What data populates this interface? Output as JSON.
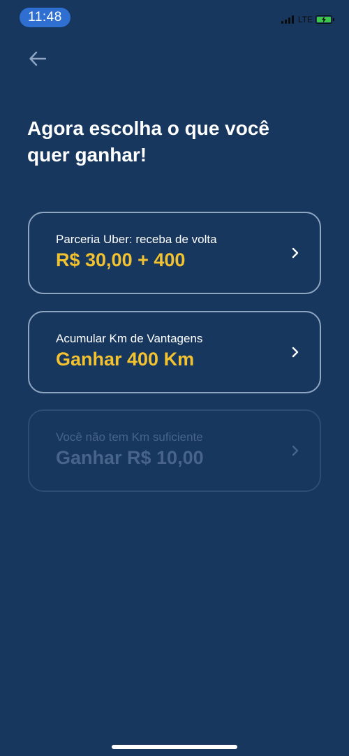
{
  "status_bar": {
    "time": "11:48",
    "network": "LTE",
    "battery_color": "#3cc84a"
  },
  "header": {
    "back_icon": "arrow-left-icon"
  },
  "page": {
    "title_line1": "Agora escolha o que você",
    "title_line2": "quer ganhar!"
  },
  "options": [
    {
      "subtitle": "Parceria Uber: receba de volta",
      "value": "R$ 30,00 + 400",
      "enabled": true
    },
    {
      "subtitle": "Acumular Km de Vantagens",
      "value": "Ganhar 400 Km",
      "enabled": true
    },
    {
      "subtitle": "Você não tem Km suficiente",
      "value": "Ganhar R$ 10,00",
      "enabled": false
    }
  ],
  "colors": {
    "background": "#17375e",
    "accent_value": "#f2c230",
    "card_border": "#8fa6c3",
    "disabled_text": "#48648a",
    "time_pill": "#2e6fd1"
  }
}
